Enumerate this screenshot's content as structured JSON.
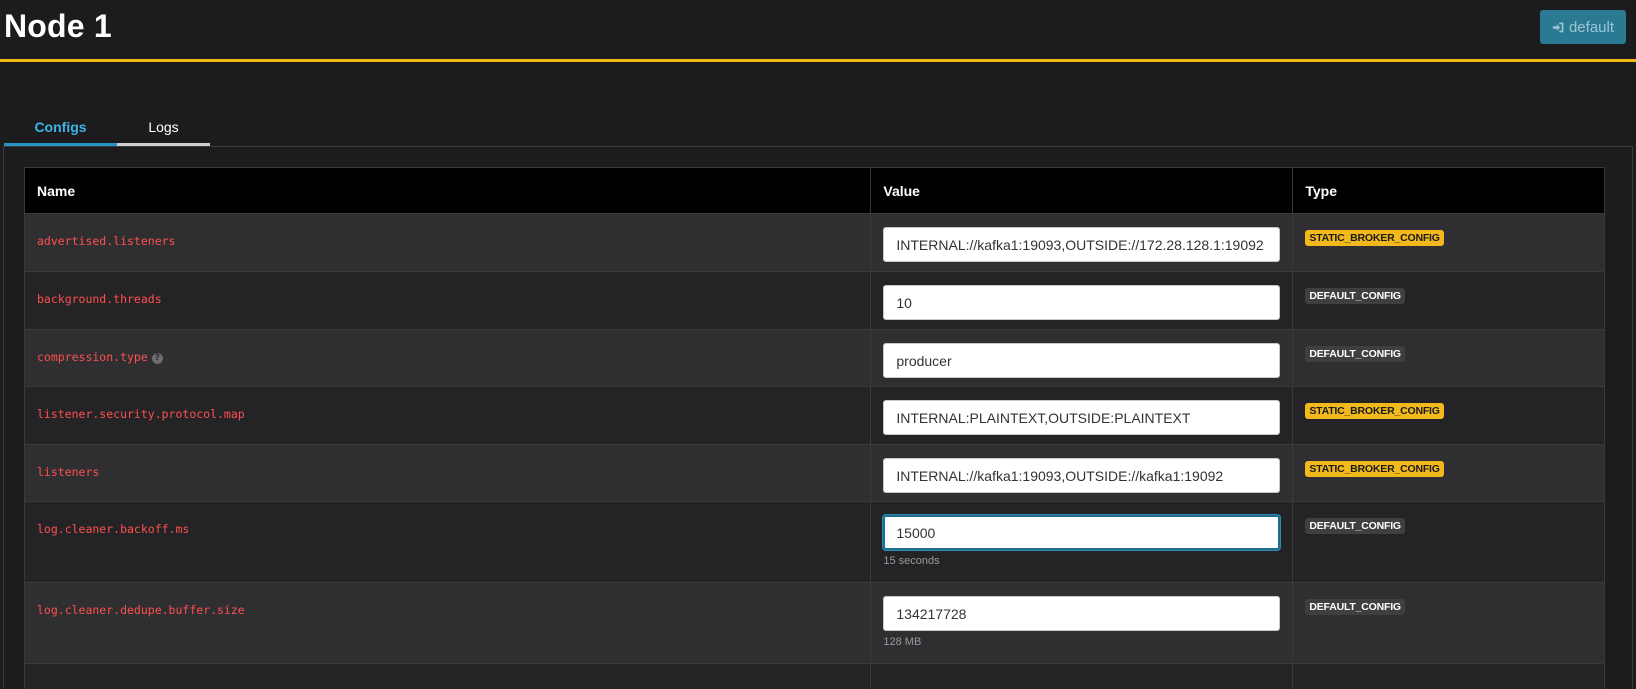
{
  "header": {
    "title": "Node 1",
    "cluster_button_label": "default",
    "cluster_button_icon": "sign-in-icon",
    "accent_color": "#f5b916"
  },
  "tabs": [
    {
      "label": "Configs",
      "active": true
    },
    {
      "label": "Logs",
      "active": false
    }
  ],
  "table": {
    "columns": [
      "Name",
      "Value",
      "Type"
    ],
    "rows": [
      {
        "name": "advertised.listeners",
        "value": "INTERNAL://kafka1:19093,OUTSIDE://172.28.128.1:19092",
        "hint": "",
        "type": "STATIC_BROKER_CONFIG",
        "help": false
      },
      {
        "name": "background.threads",
        "value": "10",
        "hint": "",
        "type": "DEFAULT_CONFIG",
        "help": false
      },
      {
        "name": "compression.type",
        "value": "producer",
        "hint": "",
        "type": "DEFAULT_CONFIG",
        "help": true
      },
      {
        "name": "listener.security.protocol.map",
        "value": "INTERNAL:PLAINTEXT,OUTSIDE:PLAINTEXT",
        "hint": "",
        "type": "STATIC_BROKER_CONFIG",
        "help": false
      },
      {
        "name": "listeners",
        "value": "INTERNAL://kafka1:19093,OUTSIDE://kafka1:19092",
        "hint": "",
        "type": "STATIC_BROKER_CONFIG",
        "help": false
      },
      {
        "name": "log.cleaner.backoff.ms",
        "value": "15000",
        "hint": "15 seconds",
        "type": "DEFAULT_CONFIG",
        "help": false,
        "focused": true
      },
      {
        "name": "log.cleaner.dedupe.buffer.size",
        "value": "134217728",
        "hint": "128 MB",
        "type": "DEFAULT_CONFIG",
        "help": false
      }
    ]
  },
  "colors": {
    "name_text": "#ff4f4f",
    "static_badge": "#f2b91c",
    "default_badge": "#3f3f42",
    "active_tab": "#3cb4e6"
  }
}
